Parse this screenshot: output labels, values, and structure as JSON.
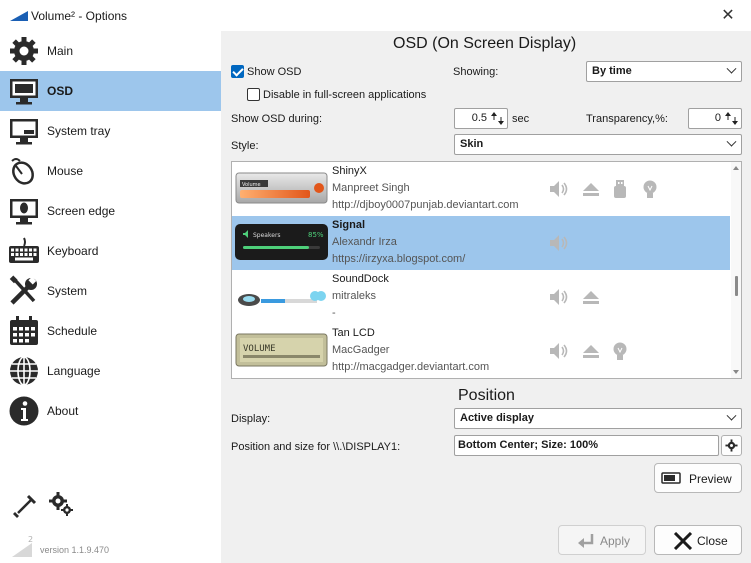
{
  "window": {
    "title": "Volume² - Options"
  },
  "sidebar": {
    "items": [
      {
        "label": "Main",
        "icon": "gear-icon"
      },
      {
        "label": "OSD",
        "icon": "monitor-icon",
        "active": true
      },
      {
        "label": "System tray",
        "icon": "tray-icon"
      },
      {
        "label": "Mouse",
        "icon": "mouse-icon"
      },
      {
        "label": "Screen edge",
        "icon": "screen-edge-icon"
      },
      {
        "label": "Keyboard",
        "icon": "keyboard-icon"
      },
      {
        "label": "System",
        "icon": "tools-icon"
      },
      {
        "label": "Schedule",
        "icon": "calendar-icon"
      },
      {
        "label": "Language",
        "icon": "globe-icon"
      },
      {
        "label": "About",
        "icon": "info-icon"
      }
    ],
    "version": "version 1.1.9.470"
  },
  "osd": {
    "title": "OSD (On Screen Display)",
    "show_osd_label": "Show OSD",
    "show_osd_checked": true,
    "disable_fullscreen_label": "Disable in full-screen applications",
    "disable_fullscreen_checked": false,
    "showing_label": "Showing:",
    "showing_value": "By time",
    "show_during_label": "Show OSD during:",
    "show_during_value": "0.5",
    "sec_label": "sec",
    "transparency_label": "Transparency,%:",
    "transparency_value": "0",
    "style_label": "Style:",
    "style_value": "Skin"
  },
  "skins": [
    {
      "name": "ShinyX",
      "author": "Manpreet Singh",
      "url": "http://djboy0007punjab.deviantart.com",
      "selected": false,
      "features": [
        "speaker-icon",
        "eject-icon",
        "usb-icon",
        "bulb-icon"
      ]
    },
    {
      "name": "Signal",
      "author": "Alexandr Irza",
      "url": "https://irzyxa.blogspot.com/",
      "selected": true,
      "features": [
        "speaker-icon"
      ],
      "preview_text": "Speakers",
      "preview_value": "85%"
    },
    {
      "name": "SoundDock",
      "author": "mitraleks",
      "url": "-",
      "selected": false,
      "features": [
        "speaker-icon",
        "eject-icon"
      ]
    },
    {
      "name": "Tan LCD",
      "author": "MacGadger",
      "url": "http://macgadger.deviantart.com",
      "selected": false,
      "features": [
        "speaker-icon",
        "eject-icon",
        "bulb-icon"
      ],
      "preview_text": "VOLUME"
    }
  ],
  "position": {
    "title": "Position",
    "display_label": "Display:",
    "display_value": "Active display",
    "pos_size_label": "Position and size for \\\\.\\DISPLAY1:",
    "pos_size_value": "Bottom Center; Size: 100%",
    "preview_label": "Preview"
  },
  "buttons": {
    "apply": "Apply",
    "close": "Close"
  },
  "colors": {
    "accent": "#0067c0",
    "selection": "#9dc6ec"
  }
}
